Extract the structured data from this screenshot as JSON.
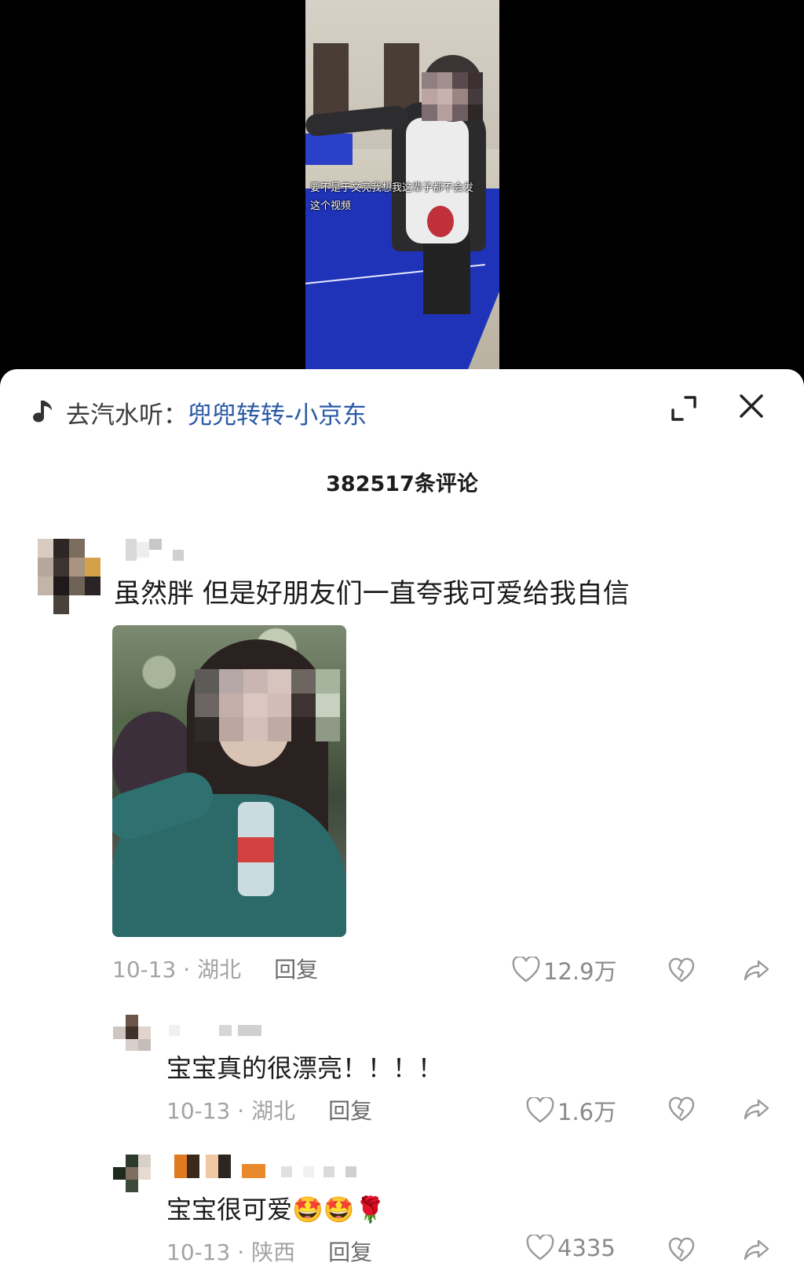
{
  "video": {
    "caption": "要不是于文亮我想我这辈子都不会发这个视频"
  },
  "music": {
    "prefix": "去汽水听：",
    "title": "兜兜转转-小京东"
  },
  "comment_count": "382517条评论",
  "comments": [
    {
      "text": "虽然胖 但是好朋友们一直夸我可爱给我自信",
      "date": "10-13 · 湖北",
      "reply": "回复",
      "likes": "12.9万"
    },
    {
      "text": "宝宝真的很漂亮！！！！",
      "date": "10-13 · 湖北",
      "reply": "回复",
      "likes": "1.6万"
    },
    {
      "text": "宝宝很可爱🤩🤩🌹",
      "date": "10-13 · 陕西",
      "reply": "回复",
      "likes": "4335"
    }
  ],
  "icons": {
    "music": "music-note-icon",
    "expand": "expand-icon",
    "close": "close-icon",
    "like": "heart-icon",
    "dislike": "broken-heart-icon",
    "share": "share-arrow-icon"
  },
  "colors": {
    "music_title": "#2a5aa6",
    "muted": "#a3a3a3"
  }
}
